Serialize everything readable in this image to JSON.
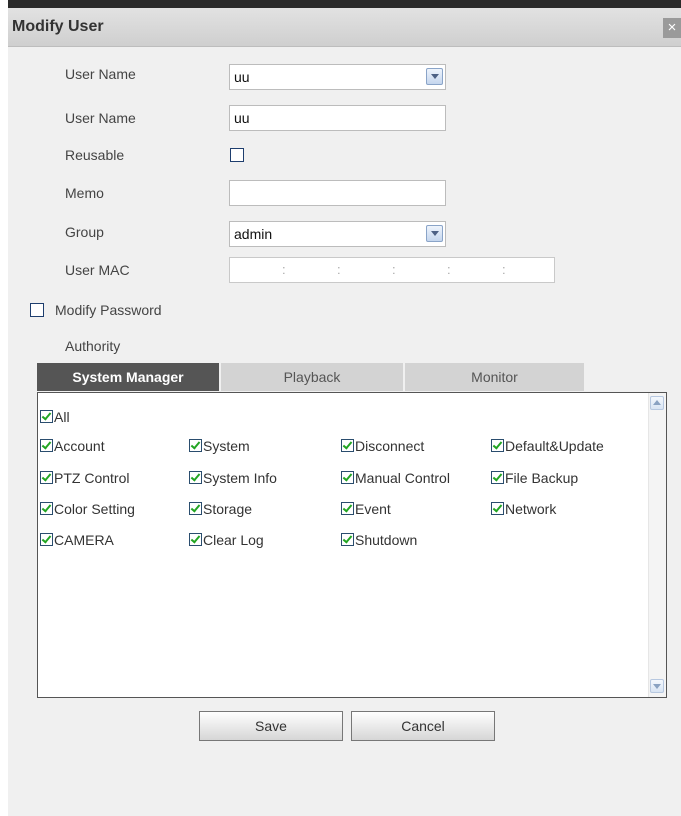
{
  "dialog": {
    "title": "Modify User",
    "close_symbol": "×"
  },
  "form": {
    "user_name_select_label": "User Name",
    "user_name_select_value": "uu",
    "user_name_label": "User Name",
    "user_name_value": "uu",
    "reusable_label": "Reusable",
    "reusable_checked": false,
    "memo_label": "Memo",
    "memo_value": "",
    "group_label": "Group",
    "group_value": "admin",
    "user_mac_label": "User MAC",
    "user_mac_value": [
      "",
      "",
      "",
      "",
      "",
      ""
    ],
    "mac_separator": ":",
    "modify_password_label": "Modify Password",
    "modify_password_checked": false,
    "authority_label": "Authority"
  },
  "tabs": [
    {
      "label": "System Manager",
      "active": true
    },
    {
      "label": "Playback",
      "active": false
    },
    {
      "label": "Monitor",
      "active": false
    }
  ],
  "permissions": {
    "all": {
      "label": "All",
      "checked": true
    },
    "items": [
      {
        "label": "Account",
        "checked": true
      },
      {
        "label": "System",
        "checked": true
      },
      {
        "label": "Disconnect",
        "checked": true
      },
      {
        "label": "Default&Update",
        "checked": true
      },
      {
        "label": "PTZ Control",
        "checked": true
      },
      {
        "label": "System Info",
        "checked": true
      },
      {
        "label": "Manual Control",
        "checked": true
      },
      {
        "label": "File Backup",
        "checked": true
      },
      {
        "label": "Color Setting",
        "checked": true
      },
      {
        "label": "Storage",
        "checked": true
      },
      {
        "label": "Event",
        "checked": true
      },
      {
        "label": "Network",
        "checked": true
      },
      {
        "label": "CAMERA",
        "checked": true
      },
      {
        "label": "Clear Log",
        "checked": true
      },
      {
        "label": "Shutdown",
        "checked": true
      }
    ]
  },
  "buttons": {
    "save": "Save",
    "cancel": "Cancel"
  },
  "colors": {
    "active_tab": "#555555",
    "inactive_tab": "#d3d3d3",
    "check_mark": "#22a522",
    "dialog_bg": "#f0f0f0"
  },
  "icons": {
    "dropdown": "chevron-down-icon",
    "close": "close-icon",
    "check": "checkmark-icon"
  }
}
